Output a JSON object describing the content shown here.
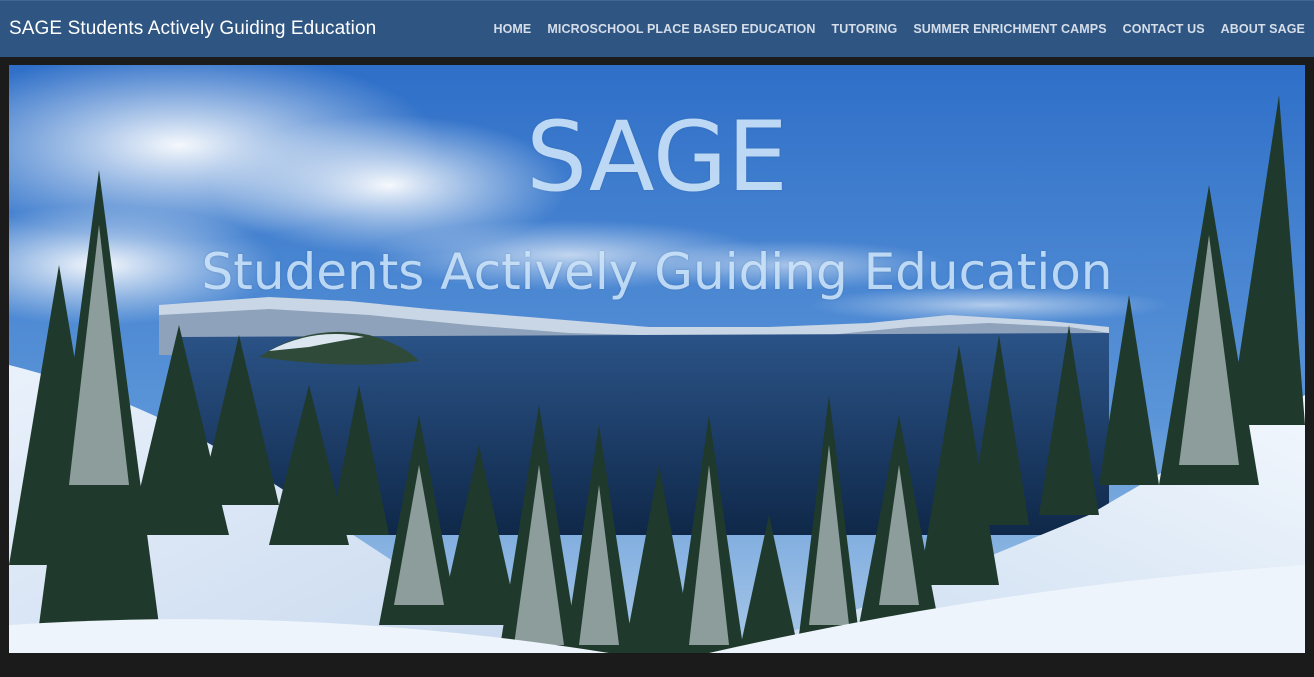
{
  "header": {
    "brand": "SAGE Students Actively Guiding Education",
    "nav": [
      {
        "label": "HOME"
      },
      {
        "label": "MICROSCHOOL PLACE BASED EDUCATION"
      },
      {
        "label": "TUTORING"
      },
      {
        "label": "SUMMER ENRICHMENT CAMPS"
      },
      {
        "label": "CONTACT US"
      },
      {
        "label": "ABOUT SAGE"
      }
    ]
  },
  "hero": {
    "title": "SAGE",
    "subtitle": "Students Actively Guiding Education"
  },
  "colors": {
    "header_bg": "#2f5683",
    "page_bg": "#1b1b1b",
    "hero_text": "#cfe6fa"
  }
}
